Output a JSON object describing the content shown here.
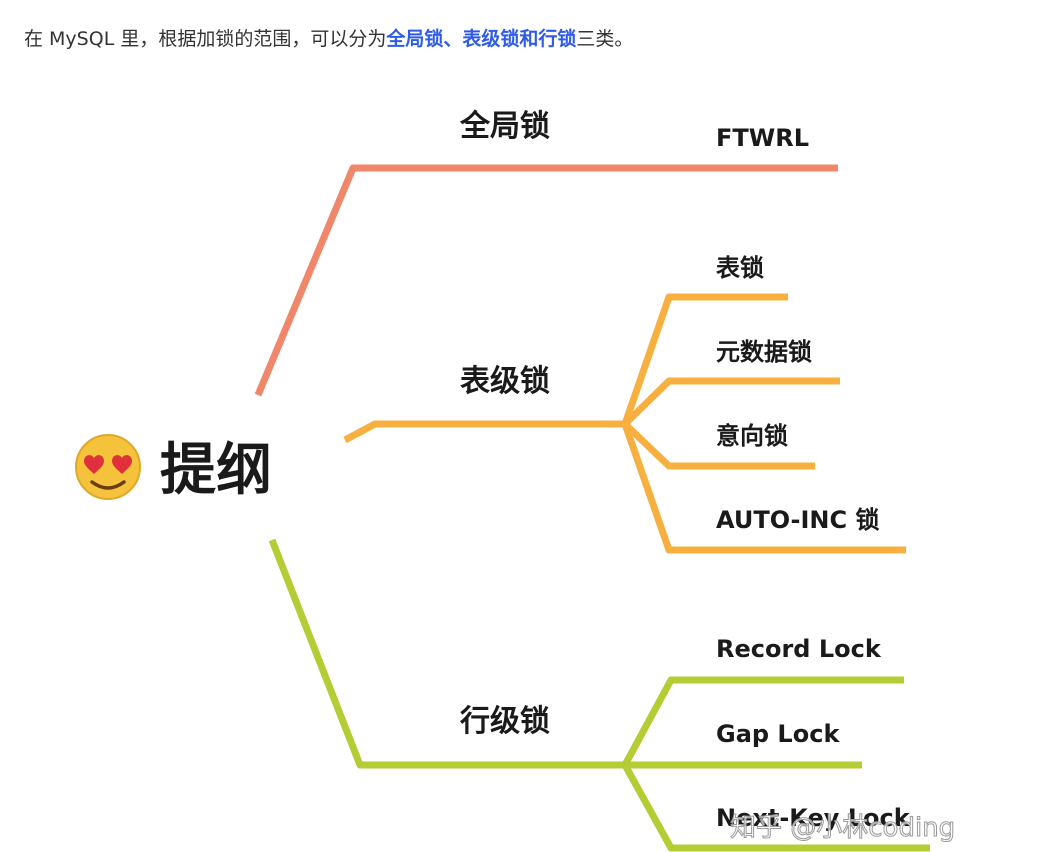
{
  "intro": {
    "prefix": "在 MySQL 里，根据加锁的范围，可以分为",
    "highlight": "全局锁、表级锁和行锁",
    "suffix": "三类。"
  },
  "mindmap": {
    "root": "提纲",
    "root_icon": "heart-eyes-emoji-icon",
    "branches": [
      {
        "label": "全局锁",
        "color": "#f0866a",
        "children": [
          "FTWRL"
        ]
      },
      {
        "label": "表级锁",
        "color": "#f7b040",
        "children": [
          "表锁",
          "元数据锁",
          "意向锁",
          "AUTO-INC 锁"
        ]
      },
      {
        "label": "行级锁",
        "color": "#b5cc34",
        "children": [
          "Record Lock",
          "Gap Lock",
          "Next-Key Lock"
        ]
      }
    ]
  },
  "watermark": "知乎 @小林coding"
}
